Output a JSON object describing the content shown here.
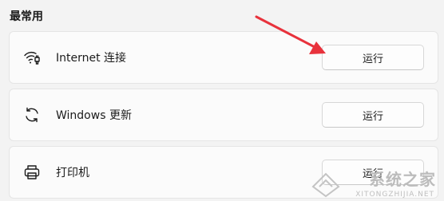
{
  "section": {
    "title": "最常用"
  },
  "items": [
    {
      "label": "Internet 连接",
      "icon": "wifi-ethernet-icon",
      "button": "运行"
    },
    {
      "label": "Windows 更新",
      "icon": "sync-icon",
      "button": "运行"
    },
    {
      "label": "打印机",
      "icon": "printer-icon",
      "button": "运行"
    }
  ],
  "annotation": {
    "color": "#e8323c"
  },
  "watermark": {
    "title": "系统之家",
    "subtitle": "XITONGZHIJIA.NET"
  }
}
